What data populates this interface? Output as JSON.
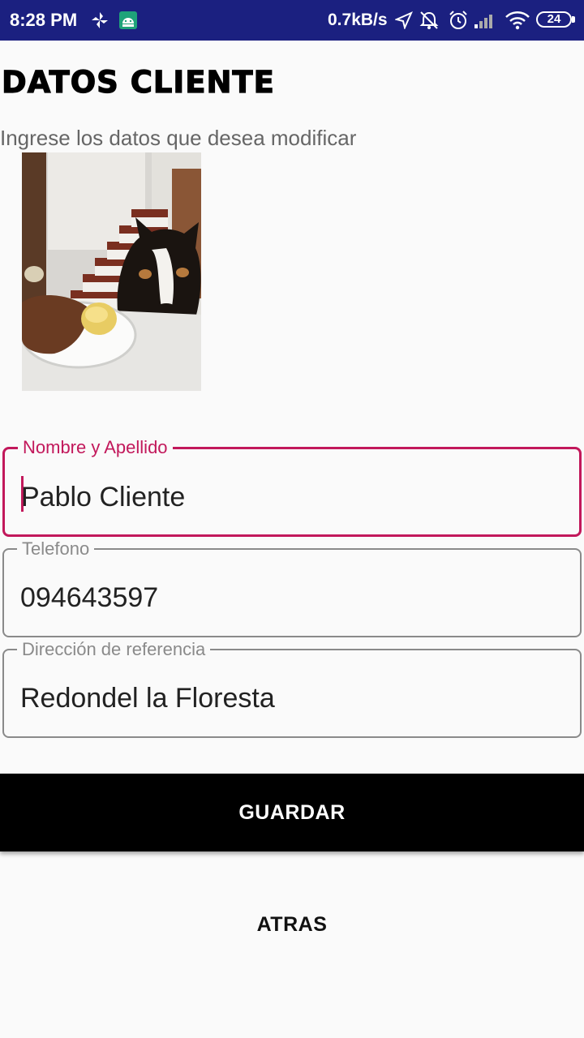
{
  "status_bar": {
    "time": "8:28 PM",
    "network_speed": "0.7kB/s",
    "battery_level": "24",
    "icons": [
      "pinwheel-icon",
      "android-debug-icon",
      "location-arrow-icon",
      "alarm-off-icon",
      "alarm-icon",
      "signal-icon",
      "wifi-icon",
      "battery-icon"
    ]
  },
  "header": {
    "title": "DATOS CLIENTE",
    "subtitle": "Ingrese los datos que desea modificar"
  },
  "photo": {
    "icon": "customer-photo"
  },
  "form": {
    "name_label": "Nombre y Apellido",
    "name_value": "Pablo Cliente",
    "phone_label": "Telefono",
    "phone_value": "094643597",
    "address_label": "Dirección de referencia",
    "address_value": "Redondel la Floresta"
  },
  "actions": {
    "save_label": "GUARDAR",
    "back_label": "ATRAS"
  },
  "colors": {
    "status_bar": "#1b2080",
    "accent": "#c2185b",
    "primary_button": "#000000",
    "background": "#fafafa"
  }
}
